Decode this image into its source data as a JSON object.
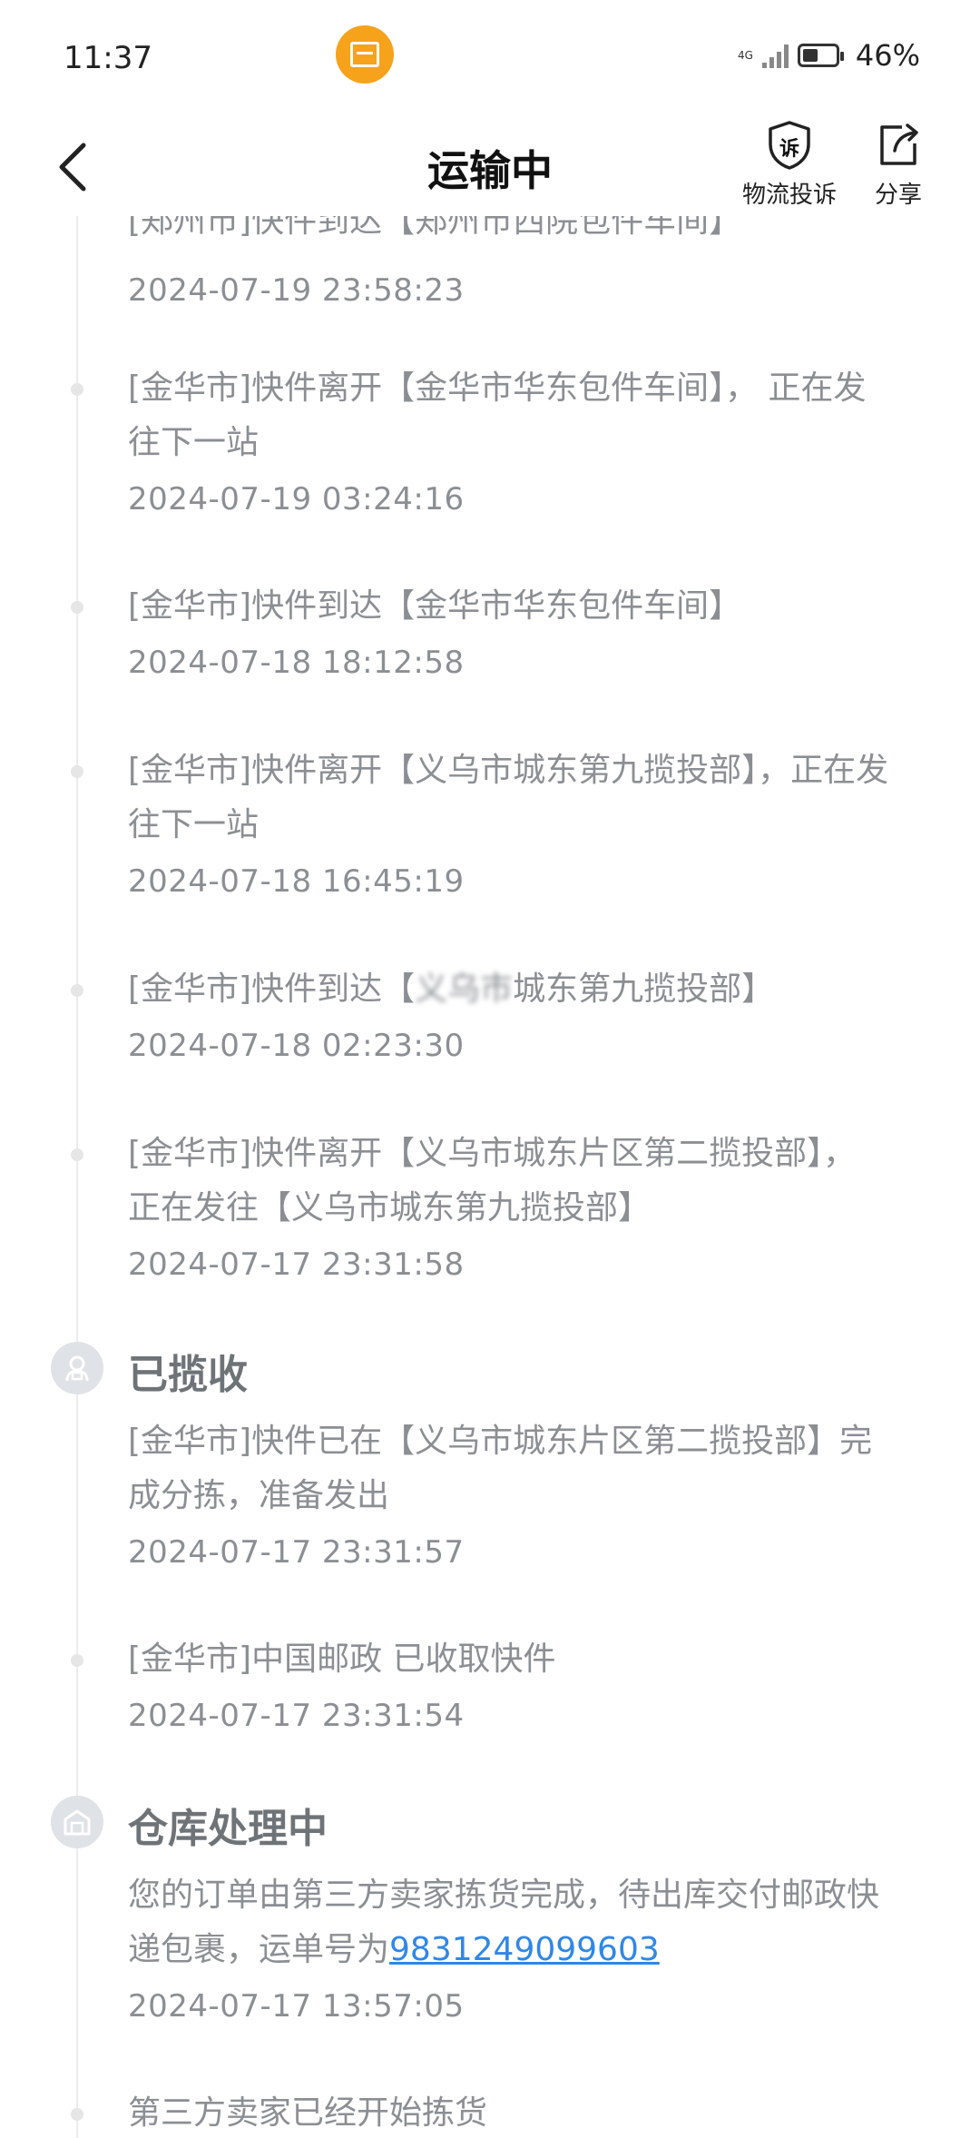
{
  "status_bar": {
    "time": "11:37",
    "network": "4G",
    "battery_percent": "46%",
    "battery_level": 0.46
  },
  "header": {
    "back_icon": "chevron-left-icon",
    "title": "运输中",
    "complain_icon_text": "诉",
    "complain_label": "物流投诉",
    "share_label": "分享"
  },
  "timeline": {
    "events": [
      {
        "text": "[郑州市]快件到达【郑州市西院包件车间】",
        "time": "2024-07-19 23:58:23"
      },
      {
        "text": "[金华市]快件离开【金华市华东包件车间】， 正在发往下一站",
        "time": "2024-07-19 03:24:16"
      },
      {
        "text": "[金华市]快件到达【金华市华东包件车间】",
        "time": "2024-07-18 18:12:58"
      },
      {
        "text": "[金华市]快件离开【义乌市城东第九揽投部】，正在发往下一站",
        "time": "2024-07-18 16:45:19"
      },
      {
        "text_prefix": "[金华市]快件到达【",
        "text_blurred": "义乌市",
        "text_suffix": "城东第九揽投部】",
        "time": "2024-07-18 02:23:30"
      },
      {
        "text": "[金华市]快件离开【义乌市城东片区第二揽投部】， 正在发往【义乌市城东第九揽投部】",
        "time": "2024-07-17 23:31:58"
      }
    ],
    "stage_collected": {
      "title": "已揽收",
      "icon": "courier-icon",
      "events": [
        {
          "text": "[金华市]快件已在【义乌市城东片区第二揽投部】完成分拣，准备发出",
          "time": "2024-07-17 23:31:57"
        },
        {
          "text": "[金华市]中国邮政 已收取快件",
          "time": "2024-07-17 23:31:54"
        }
      ]
    },
    "stage_warehouse": {
      "title": "仓库处理中",
      "icon": "warehouse-icon",
      "events": [
        {
          "text_prefix": "您的订单由第三方卖家拣货完成，待出库交付邮政快递包裹，运单号为",
          "waybill": "9831249099603",
          "time": "2024-07-17 13:57:05"
        },
        {
          "text": "第三方卖家已经开始拣货",
          "time": ""
        }
      ]
    }
  }
}
